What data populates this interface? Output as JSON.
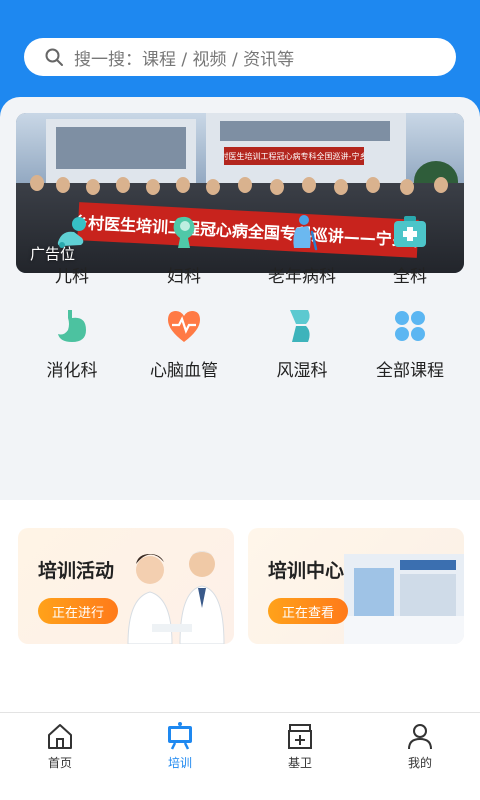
{
  "search": {
    "placeholder": "搜一搜：课程 / 视频 / 资讯等"
  },
  "banner": {
    "ad_label": "广告位",
    "banner_text": "乡村医生培训工程冠心病全国专科巡讲——宁乡站",
    "sign_text": "乡村医生培训工程冠心病专科全国巡讲-宁乡站"
  },
  "categories": [
    {
      "label": "儿科",
      "icon": "baby-icon"
    },
    {
      "label": "妇科",
      "icon": "woman-icon"
    },
    {
      "label": "老年病科",
      "icon": "elder-icon"
    },
    {
      "label": "全科",
      "icon": "medkit-icon"
    },
    {
      "label": "消化科",
      "icon": "stomach-icon"
    },
    {
      "label": "心脑血管",
      "icon": "heart-pulse-icon"
    },
    {
      "label": "风湿科",
      "icon": "knee-joint-icon"
    },
    {
      "label": "全部课程",
      "icon": "grid-icon"
    }
  ],
  "cards": [
    {
      "title": "培训活动",
      "status": "正在进行"
    },
    {
      "title": "培训中心",
      "status": "正在查看"
    }
  ],
  "tabs": [
    {
      "label": "首页",
      "icon": "home-icon",
      "active": false
    },
    {
      "label": "培训",
      "icon": "training-board-icon",
      "active": true
    },
    {
      "label": "基卫",
      "icon": "clinic-icon",
      "active": false
    },
    {
      "label": "我的",
      "icon": "user-icon",
      "active": false
    }
  ],
  "colors": {
    "primary": "#1e88f0",
    "accent_orange": "#ff8c1a",
    "icon_teal": "#36c0c5"
  }
}
